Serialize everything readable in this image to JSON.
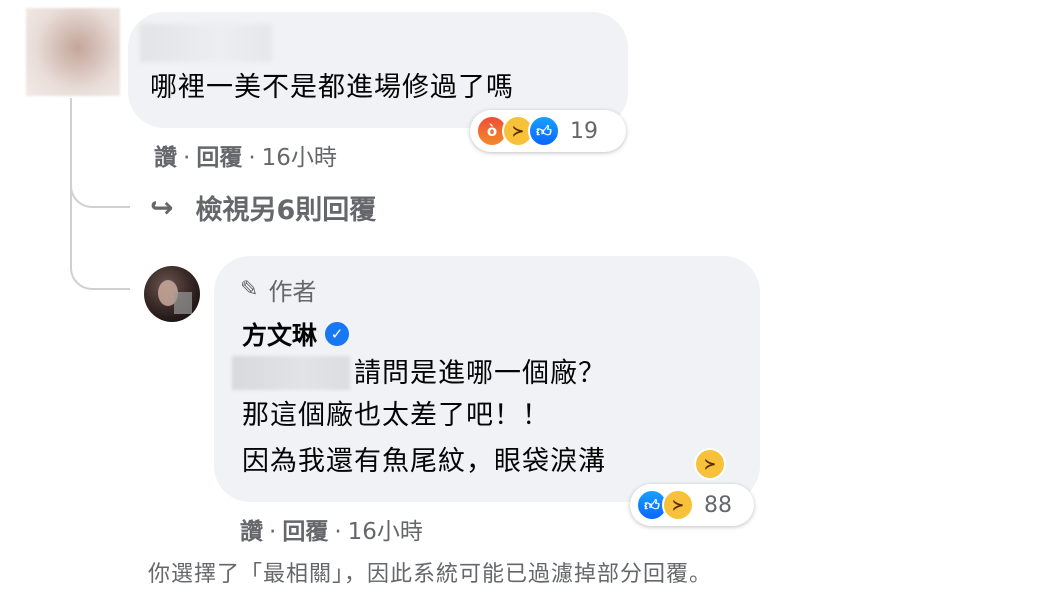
{
  "comment1": {
    "text": "哪裡一美不是都進場修過了嗎",
    "reactions": [
      "angry-reaction",
      "haha-reaction",
      "like-reaction"
    ],
    "reaction_count": "19",
    "action_like": "讚",
    "action_reply": "回覆",
    "timestamp": "16小時"
  },
  "view_more": {
    "label": "檢視另6則回覆"
  },
  "reply": {
    "author_badge": "作者",
    "author_name": "方文琳",
    "line1_suffix": "請問是進哪一個廠？",
    "line2": "那這個廠也太差了吧！！",
    "line3": "因為我還有魚尾紋，眼袋淚溝",
    "reactions": [
      "like-reaction",
      "haha-reaction"
    ],
    "reaction_count": "88",
    "action_like": "讚",
    "action_reply": "回覆",
    "timestamp": "16小時"
  },
  "footer": {
    "notice": "你選擇了「最相關」，因此系統可能已過濾掉部分回覆。"
  },
  "colors": {
    "bubble_bg": "#f0f2f5",
    "secondary_text": "#65676b",
    "verified_blue": "#1877f2",
    "thread_line": "#ced0d4"
  }
}
